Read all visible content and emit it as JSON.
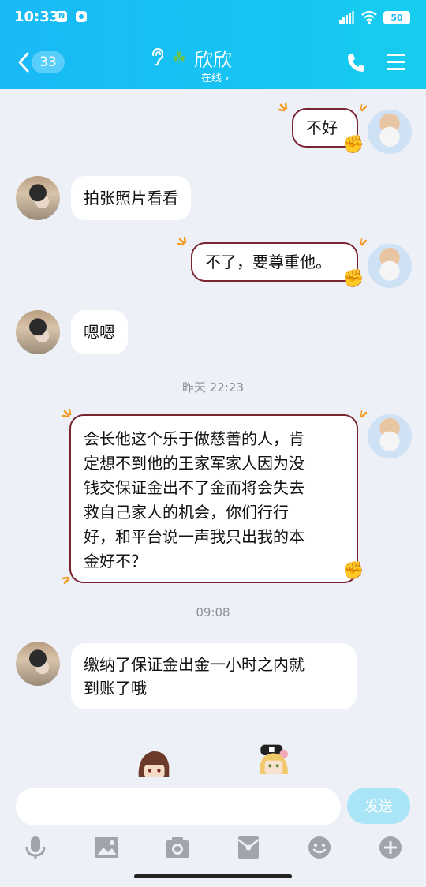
{
  "status_bar": {
    "time": "10:33",
    "notif_n": "N",
    "battery": "50"
  },
  "header": {
    "back_count": "33",
    "contact_name": "欣欣",
    "online_status": "在线 ›",
    "accent_color": "#19b9f6"
  },
  "messages": [
    {
      "side": "right",
      "text": "不好"
    },
    {
      "side": "left",
      "text": "拍张照片看看"
    },
    {
      "side": "right",
      "text": "不了，要尊重他。"
    },
    {
      "side": "left",
      "text": "嗯嗯"
    },
    {
      "side": "timestamp",
      "text": "昨天 22:23"
    },
    {
      "side": "right",
      "lines": [
        "会长他这个乐于做慈善的人，肯",
        "定想不到他的王家军家人因为没",
        "钱交保证金出不了金而将会失去",
        "救自己家人的机会，你们行行",
        "好，和平台说一声我只出我的本",
        "金好不？"
      ]
    },
    {
      "side": "timestamp",
      "text": "09:08"
    },
    {
      "side": "left",
      "lines": [
        "缴纳了保证金出金一小时之内就",
        "到账了哦"
      ]
    }
  ],
  "input": {
    "placeholder": "",
    "value": "",
    "send_label": "发送"
  },
  "toolbar": {
    "icons": [
      "microphone-icon",
      "image-icon",
      "camera-icon",
      "red-packet-icon",
      "emoji-icon",
      "plus-icon"
    ]
  }
}
